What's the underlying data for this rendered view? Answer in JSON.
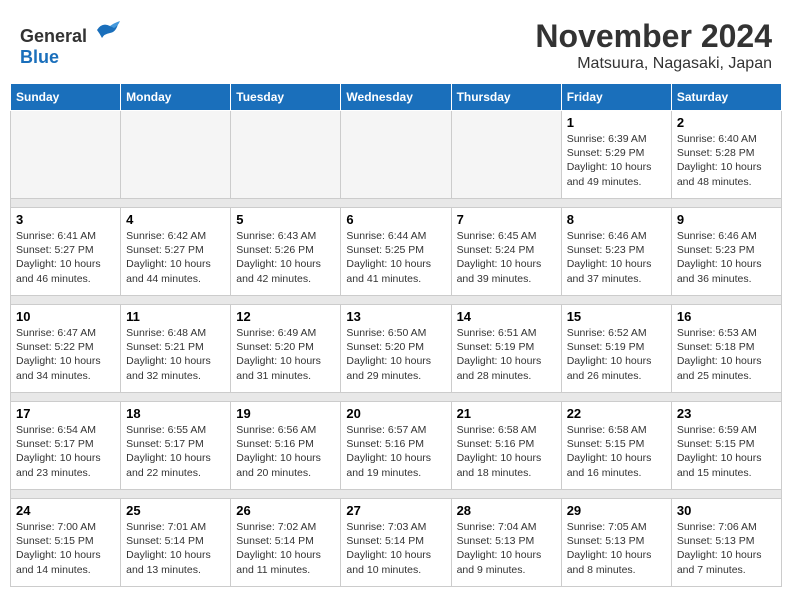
{
  "logo": {
    "general": "General",
    "blue": "Blue"
  },
  "title": {
    "month": "November 2024",
    "location": "Matsuura, Nagasaki, Japan"
  },
  "weekdays": [
    "Sunday",
    "Monday",
    "Tuesday",
    "Wednesday",
    "Thursday",
    "Friday",
    "Saturday"
  ],
  "weeks": [
    [
      {
        "day": "",
        "empty": true
      },
      {
        "day": "",
        "empty": true
      },
      {
        "day": "",
        "empty": true
      },
      {
        "day": "",
        "empty": true
      },
      {
        "day": "",
        "empty": true
      },
      {
        "day": "1",
        "sunrise": "Sunrise: 6:39 AM",
        "sunset": "Sunset: 5:29 PM",
        "daylight": "Daylight: 10 hours and 49 minutes."
      },
      {
        "day": "2",
        "sunrise": "Sunrise: 6:40 AM",
        "sunset": "Sunset: 5:28 PM",
        "daylight": "Daylight: 10 hours and 48 minutes."
      }
    ],
    [
      {
        "day": "3",
        "sunrise": "Sunrise: 6:41 AM",
        "sunset": "Sunset: 5:27 PM",
        "daylight": "Daylight: 10 hours and 46 minutes."
      },
      {
        "day": "4",
        "sunrise": "Sunrise: 6:42 AM",
        "sunset": "Sunset: 5:27 PM",
        "daylight": "Daylight: 10 hours and 44 minutes."
      },
      {
        "day": "5",
        "sunrise": "Sunrise: 6:43 AM",
        "sunset": "Sunset: 5:26 PM",
        "daylight": "Daylight: 10 hours and 42 minutes."
      },
      {
        "day": "6",
        "sunrise": "Sunrise: 6:44 AM",
        "sunset": "Sunset: 5:25 PM",
        "daylight": "Daylight: 10 hours and 41 minutes."
      },
      {
        "day": "7",
        "sunrise": "Sunrise: 6:45 AM",
        "sunset": "Sunset: 5:24 PM",
        "daylight": "Daylight: 10 hours and 39 minutes."
      },
      {
        "day": "8",
        "sunrise": "Sunrise: 6:46 AM",
        "sunset": "Sunset: 5:23 PM",
        "daylight": "Daylight: 10 hours and 37 minutes."
      },
      {
        "day": "9",
        "sunrise": "Sunrise: 6:46 AM",
        "sunset": "Sunset: 5:23 PM",
        "daylight": "Daylight: 10 hours and 36 minutes."
      }
    ],
    [
      {
        "day": "10",
        "sunrise": "Sunrise: 6:47 AM",
        "sunset": "Sunset: 5:22 PM",
        "daylight": "Daylight: 10 hours and 34 minutes."
      },
      {
        "day": "11",
        "sunrise": "Sunrise: 6:48 AM",
        "sunset": "Sunset: 5:21 PM",
        "daylight": "Daylight: 10 hours and 32 minutes."
      },
      {
        "day": "12",
        "sunrise": "Sunrise: 6:49 AM",
        "sunset": "Sunset: 5:20 PM",
        "daylight": "Daylight: 10 hours and 31 minutes."
      },
      {
        "day": "13",
        "sunrise": "Sunrise: 6:50 AM",
        "sunset": "Sunset: 5:20 PM",
        "daylight": "Daylight: 10 hours and 29 minutes."
      },
      {
        "day": "14",
        "sunrise": "Sunrise: 6:51 AM",
        "sunset": "Sunset: 5:19 PM",
        "daylight": "Daylight: 10 hours and 28 minutes."
      },
      {
        "day": "15",
        "sunrise": "Sunrise: 6:52 AM",
        "sunset": "Sunset: 5:19 PM",
        "daylight": "Daylight: 10 hours and 26 minutes."
      },
      {
        "day": "16",
        "sunrise": "Sunrise: 6:53 AM",
        "sunset": "Sunset: 5:18 PM",
        "daylight": "Daylight: 10 hours and 25 minutes."
      }
    ],
    [
      {
        "day": "17",
        "sunrise": "Sunrise: 6:54 AM",
        "sunset": "Sunset: 5:17 PM",
        "daylight": "Daylight: 10 hours and 23 minutes."
      },
      {
        "day": "18",
        "sunrise": "Sunrise: 6:55 AM",
        "sunset": "Sunset: 5:17 PM",
        "daylight": "Daylight: 10 hours and 22 minutes."
      },
      {
        "day": "19",
        "sunrise": "Sunrise: 6:56 AM",
        "sunset": "Sunset: 5:16 PM",
        "daylight": "Daylight: 10 hours and 20 minutes."
      },
      {
        "day": "20",
        "sunrise": "Sunrise: 6:57 AM",
        "sunset": "Sunset: 5:16 PM",
        "daylight": "Daylight: 10 hours and 19 minutes."
      },
      {
        "day": "21",
        "sunrise": "Sunrise: 6:58 AM",
        "sunset": "Sunset: 5:16 PM",
        "daylight": "Daylight: 10 hours and 18 minutes."
      },
      {
        "day": "22",
        "sunrise": "Sunrise: 6:58 AM",
        "sunset": "Sunset: 5:15 PM",
        "daylight": "Daylight: 10 hours and 16 minutes."
      },
      {
        "day": "23",
        "sunrise": "Sunrise: 6:59 AM",
        "sunset": "Sunset: 5:15 PM",
        "daylight": "Daylight: 10 hours and 15 minutes."
      }
    ],
    [
      {
        "day": "24",
        "sunrise": "Sunrise: 7:00 AM",
        "sunset": "Sunset: 5:15 PM",
        "daylight": "Daylight: 10 hours and 14 minutes."
      },
      {
        "day": "25",
        "sunrise": "Sunrise: 7:01 AM",
        "sunset": "Sunset: 5:14 PM",
        "daylight": "Daylight: 10 hours and 13 minutes."
      },
      {
        "day": "26",
        "sunrise": "Sunrise: 7:02 AM",
        "sunset": "Sunset: 5:14 PM",
        "daylight": "Daylight: 10 hours and 11 minutes."
      },
      {
        "day": "27",
        "sunrise": "Sunrise: 7:03 AM",
        "sunset": "Sunset: 5:14 PM",
        "daylight": "Daylight: 10 hours and 10 minutes."
      },
      {
        "day": "28",
        "sunrise": "Sunrise: 7:04 AM",
        "sunset": "Sunset: 5:13 PM",
        "daylight": "Daylight: 10 hours and 9 minutes."
      },
      {
        "day": "29",
        "sunrise": "Sunrise: 7:05 AM",
        "sunset": "Sunset: 5:13 PM",
        "daylight": "Daylight: 10 hours and 8 minutes."
      },
      {
        "day": "30",
        "sunrise": "Sunrise: 7:06 AM",
        "sunset": "Sunset: 5:13 PM",
        "daylight": "Daylight: 10 hours and 7 minutes."
      }
    ]
  ]
}
